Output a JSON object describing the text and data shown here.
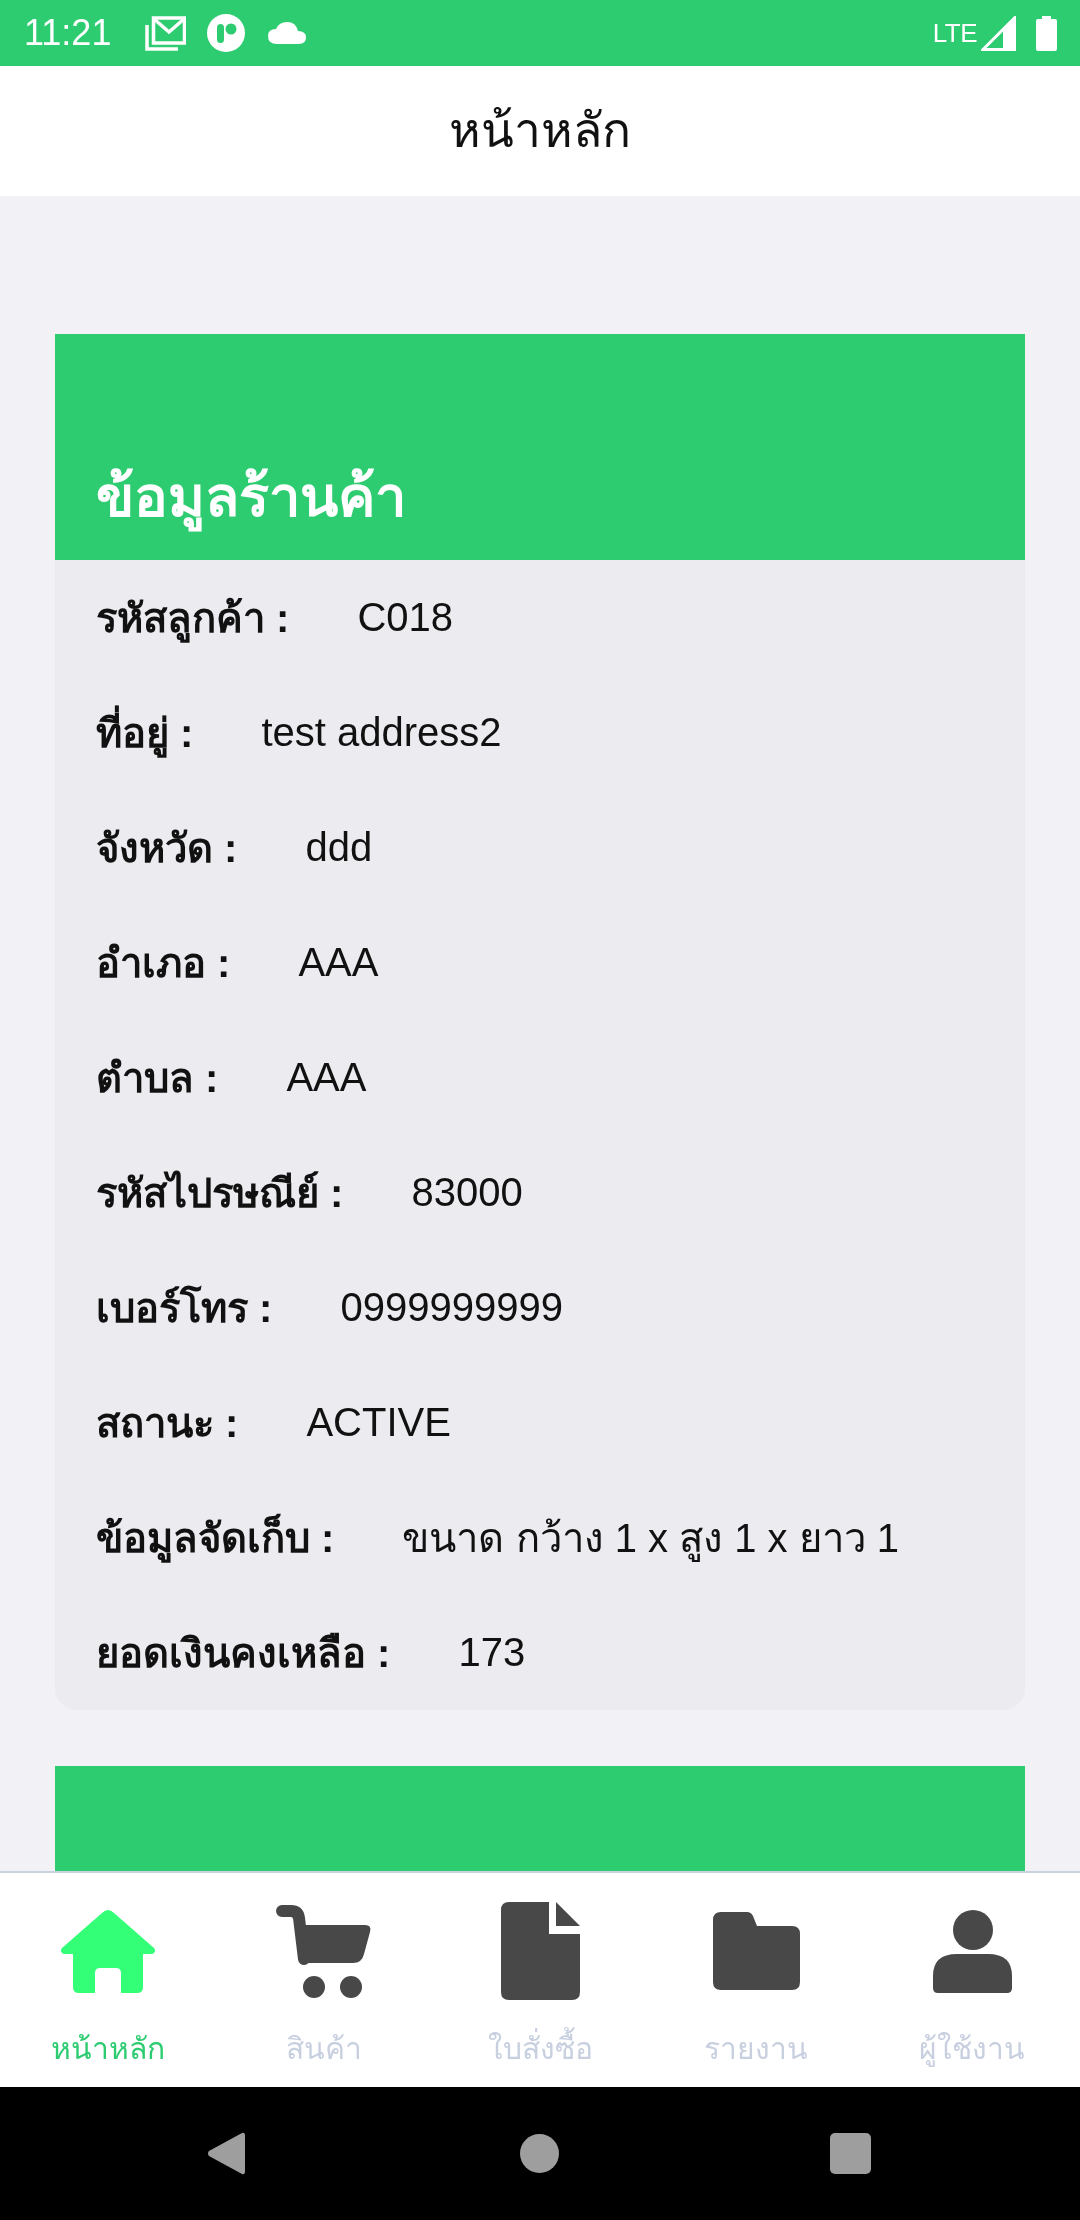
{
  "status_bar": {
    "time": "11:21",
    "network": "LTE"
  },
  "app_bar": {
    "title": "หน้าหลัก"
  },
  "cards": [
    {
      "kind": "details",
      "title": "ข้อมูลร้านค้า",
      "fields": [
        {
          "label": "รหัสลูกค้า :",
          "value": "C018"
        },
        {
          "label": "ที่อยู่ :",
          "value": "test address2"
        },
        {
          "label": "จังหวัด :",
          "value": "ddd"
        },
        {
          "label": "อำเภอ :",
          "value": "AAA"
        },
        {
          "label": "ตำบล :",
          "value": "AAA"
        },
        {
          "label": "รหัสไปรษณีย์ :",
          "value": "83000"
        },
        {
          "label": "เบอร์โทร :",
          "value": "0999999999"
        },
        {
          "label": "สถานะ :",
          "value": "ACTIVE"
        },
        {
          "label": "ข้อมูลจัดเก็บ :",
          "value": "ขนาด กว้าง 1 x สูง 1 x ยาว 1"
        },
        {
          "label": "ยอดเงินคงเหลือ :",
          "value": "173"
        }
      ]
    },
    {
      "kind": "header_only"
    }
  ],
  "bottom_nav": {
    "items": [
      {
        "label": "หน้าหลัก",
        "selected": true
      },
      {
        "label": "สินค้า",
        "selected": false
      },
      {
        "label": "ใบสั่งซื้อ",
        "selected": false
      },
      {
        "label": "รายงาน",
        "selected": false
      },
      {
        "label": "ผู้ใช้งาน",
        "selected": false
      }
    ]
  }
}
